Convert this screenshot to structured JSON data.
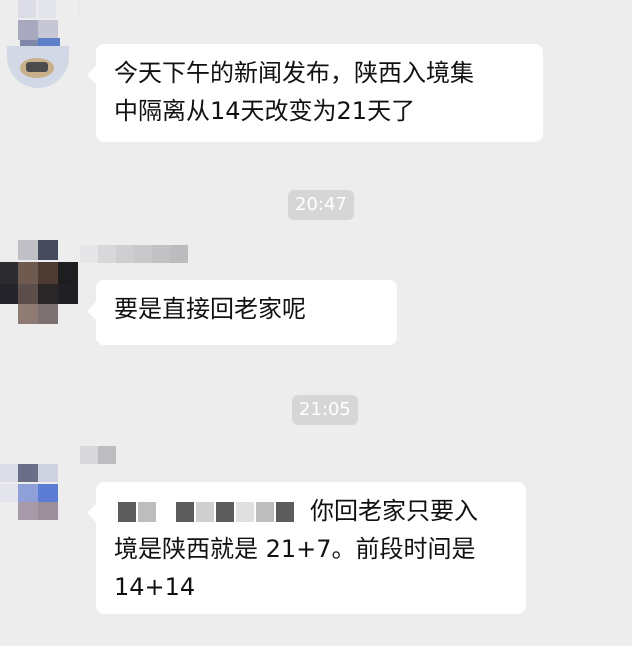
{
  "messages": [
    {
      "text_line1": "今天下午的新闻发布，陕西入境集",
      "text_line2": "中隔离从14天改变为21天了"
    },
    {
      "text": "要是直接回老家呢"
    },
    {
      "text_line1_suffix": "你回老家只要入",
      "text_line2": "境是陕西就是 21+7。前段时间是",
      "text_line3": "14+14"
    }
  ],
  "timestamps": [
    "20:47",
    "21:05"
  ],
  "colors": {
    "background": "#ededed",
    "bubble": "#ffffff",
    "timestamp_bg": "#d6d6d6"
  }
}
